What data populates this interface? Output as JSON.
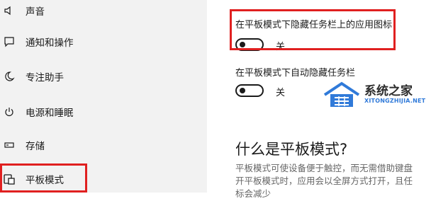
{
  "sidebar": {
    "items": [
      {
        "label": "声音",
        "icon": "speaker-icon"
      },
      {
        "label": "通知和操作",
        "icon": "notification-icon"
      },
      {
        "label": "专注助手",
        "icon": "moon-icon"
      },
      {
        "label": "电源和睡眠",
        "icon": "power-icon"
      },
      {
        "label": "存储",
        "icon": "storage-icon"
      },
      {
        "label": "平板模式",
        "icon": "tablet-mode-icon",
        "selected": true
      }
    ]
  },
  "settings": {
    "hide_app_icons": {
      "label": "在平板模式下隐藏任务栏上的应用图标",
      "state": "关",
      "on": false
    },
    "auto_hide_taskbar": {
      "label": "在平板模式下自动隐藏任务栏",
      "state": "关",
      "on": false
    }
  },
  "section": {
    "title": "什么是平板模式?",
    "desc_line1": "平板模式可使设备便于触控，而无需借助键盘",
    "desc_line2": "开平板模式时，应用会以全屏方式打开，且任",
    "desc_line3": "标会减少"
  },
  "watermark": {
    "name": "系统之家",
    "url": "XITONGZHIJIA.NET"
  },
  "colors": {
    "highlight": "#e02020",
    "sidebar_bg": "#f2f2f2",
    "watermark_blue": "#1f6fd6"
  }
}
